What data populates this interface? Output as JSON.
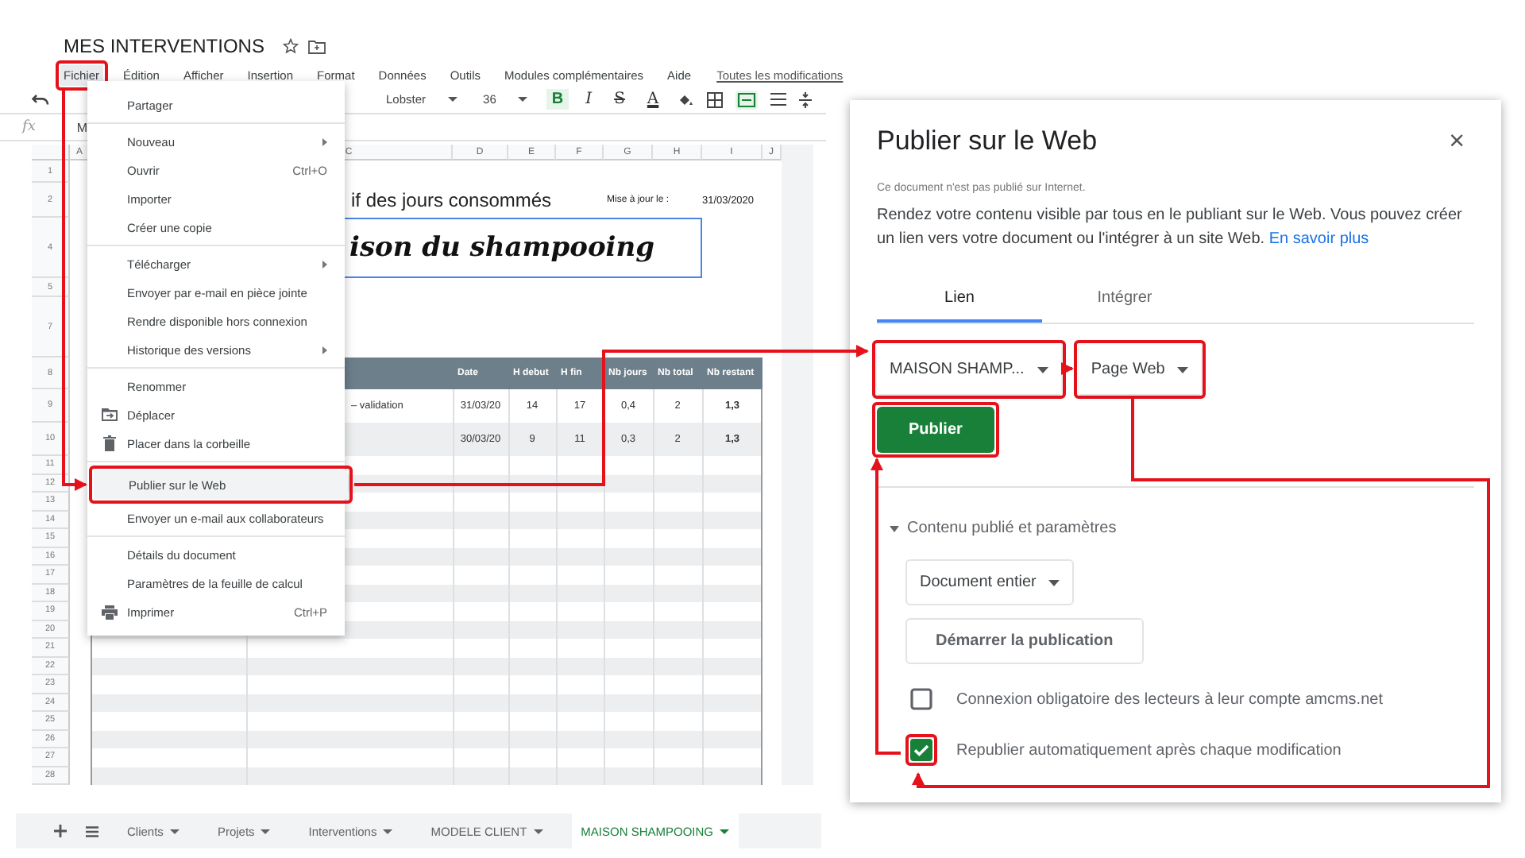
{
  "sheet": {
    "title": "MES INTERVENTIONS",
    "menu": [
      {
        "label": "Fichier",
        "selected": true
      },
      {
        "label": "Édition",
        "selected": false
      },
      {
        "label": "Afficher",
        "selected": false
      },
      {
        "label": "Insertion",
        "selected": false
      },
      {
        "label": "Format",
        "selected": false
      },
      {
        "label": "Données",
        "selected": false
      },
      {
        "label": "Outils",
        "selected": false
      },
      {
        "label": "Modules complémentaires",
        "selected": false
      },
      {
        "label": "Aide",
        "selected": false
      }
    ],
    "changes_link": "Toutes les modifications",
    "toolbar": {
      "font": "Lobster",
      "size": "36",
      "merge_selected": true,
      "format_buttons": [
        {
          "kind": "bold",
          "label": "B",
          "selected": true
        },
        {
          "kind": "italic",
          "label": "I",
          "selected": false
        },
        {
          "kind": "strike",
          "label": "S",
          "selected": false
        },
        {
          "kind": "color",
          "label": "A",
          "selected": false
        }
      ]
    },
    "formula_bar": {
      "label": "fx",
      "value": "M"
    },
    "column_headers": [
      "A",
      "C",
      "D",
      "E",
      "F",
      "G",
      "H",
      "I",
      "J"
    ],
    "row_numbers": [
      "1",
      "2",
      "4",
      "5",
      "7",
      "8",
      "9",
      "10",
      "11",
      "12",
      "13",
      "14",
      "15",
      "16",
      "17",
      "18",
      "19",
      "20",
      "21",
      "22",
      "23",
      "24",
      "25",
      "26",
      "27",
      "28"
    ],
    "subtitle": "if des jours consommés",
    "update_label": "Mise à jour le :",
    "update_date": "31/03/2020",
    "banner": "ison du shampooing",
    "table": {
      "columns": [
        "Date",
        "H debut",
        "H fin",
        "Nb jours",
        "Nb total",
        "Nb restant"
      ],
      "rows": [
        {
          "task": "– validation",
          "cells": [
            "31/03/20",
            "14",
            "17",
            "0,4",
            "2",
            "1,3"
          ]
        },
        {
          "task": "",
          "cells": [
            "30/03/20",
            "9",
            "11",
            "0,3",
            "2",
            "1,3"
          ]
        }
      ]
    },
    "file_menu": [
      [
        {
          "label": "Partager",
          "kind": "plain",
          "submenu": false,
          "selected": false
        }
      ],
      [
        {
          "label": "Nouveau",
          "kind": "plain",
          "submenu": true,
          "selected": false
        },
        {
          "label": "Ouvrir",
          "kind": "plain",
          "shortcut": "Ctrl+O",
          "submenu": false,
          "selected": false
        },
        {
          "label": "Importer",
          "kind": "plain",
          "submenu": false,
          "selected": false
        },
        {
          "label": "Créer une copie",
          "kind": "plain",
          "submenu": false,
          "selected": false
        }
      ],
      [
        {
          "label": "Télécharger",
          "kind": "plain",
          "submenu": true,
          "selected": false
        },
        {
          "label": "Envoyer par e-mail en pièce jointe",
          "kind": "plain",
          "submenu": false,
          "selected": false
        },
        {
          "label": "Rendre disponible hors connexion",
          "kind": "plain",
          "submenu": false,
          "selected": false
        },
        {
          "label": "Historique des versions",
          "kind": "plain",
          "submenu": true,
          "selected": false
        }
      ],
      [
        {
          "label": "Renommer",
          "kind": "plain",
          "submenu": false,
          "selected": false
        },
        {
          "label": "Déplacer",
          "kind": "folder",
          "submenu": false,
          "selected": false
        },
        {
          "label": "Placer dans la corbeille",
          "kind": "trash",
          "submenu": false,
          "selected": false
        }
      ],
      [
        {
          "label": "Publier sur le Web",
          "kind": "plain",
          "submenu": false,
          "selected": true
        },
        {
          "label": "Envoyer un e-mail aux collaborateurs",
          "kind": "plain",
          "submenu": false,
          "selected": false
        }
      ],
      [
        {
          "label": "Détails du document",
          "kind": "plain",
          "submenu": false,
          "selected": false
        },
        {
          "label": "Paramètres de la feuille de calcul",
          "kind": "plain",
          "submenu": false,
          "selected": false
        },
        {
          "label": "Imprimer",
          "kind": "printer",
          "shortcut": "Ctrl+P",
          "submenu": false,
          "selected": false
        }
      ]
    ],
    "sheet_tabs": [
      {
        "label": "Clients",
        "selected": false
      },
      {
        "label": "Projets",
        "selected": false
      },
      {
        "label": "Interventions",
        "selected": false
      },
      {
        "label": "MODELE CLIENT",
        "selected": false
      },
      {
        "label": "MAISON SHAMPOOING",
        "selected": true
      }
    ]
  },
  "dialog": {
    "title": "Publier sur le Web",
    "close": "×",
    "status": "Ce document n'est pas publié sur Internet.",
    "description": "Rendez votre contenu visible par tous en le publiant sur le Web. Vous pouvez créer un lien vers votre document ou l'intégrer à un site Web.",
    "learn_more": "En savoir plus",
    "tabs": [
      {
        "label": "Lien",
        "selected": true
      },
      {
        "label": "Intégrer",
        "selected": false
      }
    ],
    "sheet_select": "MAISON SHAMP...",
    "format_select": "Page Web",
    "publish_button": "Publier",
    "section": {
      "label": "Contenu publié et paramètres",
      "expanded": true
    },
    "scope_select": "Document entier",
    "start_button": "Démarrer la publication",
    "options": [
      {
        "label": "Connexion obligatoire des lecteurs à leur compte amcms.net",
        "checked": false
      },
      {
        "label": "Republier automatiquement après chaque modification",
        "checked": true
      }
    ]
  }
}
